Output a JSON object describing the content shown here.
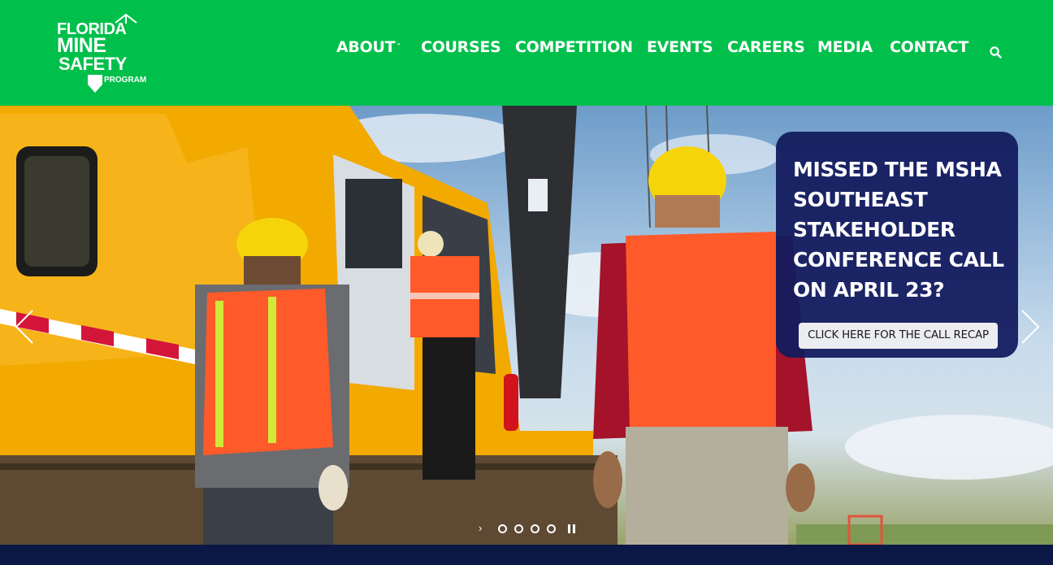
{
  "logo": {
    "line1": "FLORIDA",
    "line2": "MINE",
    "line3": "SAFETY",
    "line4": "PROGRAM"
  },
  "nav": {
    "items": [
      {
        "label": "ABOUT",
        "has_dropdown": true
      },
      {
        "label": "COURSES"
      },
      {
        "label": "COMPETITION"
      },
      {
        "label": "EVENTS"
      },
      {
        "label": "CAREERS"
      },
      {
        "label": "MEDIA"
      },
      {
        "label": "CONTACT"
      }
    ],
    "dropdown_glyph": "˅",
    "search_icon": "search-icon"
  },
  "hero": {
    "callout_title": "MISSED THE MSHA SOUTHEAST STAKEHOLDER CONFERENCE CALL ON APRIL 23?",
    "callout_button": "CLICK HERE FOR THE CALL RECAP",
    "slide_count": 4,
    "prev_icon": "chevron-left-icon",
    "next_icon": "chevron-right-icon"
  },
  "colors": {
    "header_green": "#00c04b",
    "callout_navy": "#121b5d",
    "footer_navy": "#0b1744",
    "machine_yellow": "#f2a900",
    "vest_orange": "#ff5a2a",
    "helmet_yellow": "#f5d40c"
  }
}
